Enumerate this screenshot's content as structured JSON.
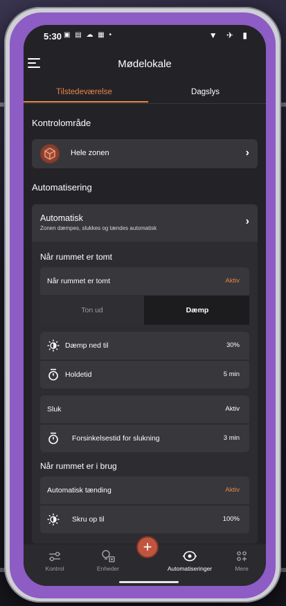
{
  "status_bar": {
    "time": "5:30",
    "left_icons": "▣ ▤ ☁ ▦ •",
    "right_icons": "▼ ✈ ▮"
  },
  "app_bar": {
    "title": "Mødelokale"
  },
  "tabs": [
    {
      "label": "Tilstedeværelse",
      "active": true
    },
    {
      "label": "Dagslys",
      "active": false
    }
  ],
  "control_area": {
    "title": "Kontrolområde",
    "zone_label": "Hele zonen"
  },
  "automation": {
    "title": "Automatisering",
    "mode_title": "Automatisk",
    "mode_subtitle": "Zonen dæmpes, slukkes og tændes automatisk",
    "vacant": {
      "title": "Når rummet er tomt",
      "row_label": "Når rummet er tomt",
      "row_value": "Aktiv",
      "seg_left": "Ton ud",
      "seg_right": "Dæmp",
      "dim_label": "Dæmp ned til",
      "dim_value": "30%",
      "hold_label": "Holdetid",
      "hold_value": "5 min",
      "off_label": "Sluk",
      "off_value": "Aktiv",
      "delay_label": "Forsinkelsestid for slukning",
      "delay_value": "3 min"
    },
    "occupied": {
      "title": "Når rummet er i brug",
      "auto_on_label": "Automatisk tænding",
      "auto_on_value": "Aktiv",
      "turn_up_label": "Skru op til",
      "turn_up_value": "100%"
    }
  },
  "bottom_nav": [
    {
      "label": "Kontrol",
      "icon": "sliders-icon"
    },
    {
      "label": "Enheder",
      "icon": "bulb-devices-icon"
    },
    {
      "label": "Automatiseringer",
      "icon": "automation-eye-icon",
      "active": true
    },
    {
      "label": "Mere",
      "icon": "more-grid-icon"
    }
  ],
  "fab": {
    "symbol": "+"
  },
  "colors": {
    "accent": "#e8844a",
    "background": "#232327",
    "card": "#36363b",
    "frame": "#8d5cc4"
  }
}
